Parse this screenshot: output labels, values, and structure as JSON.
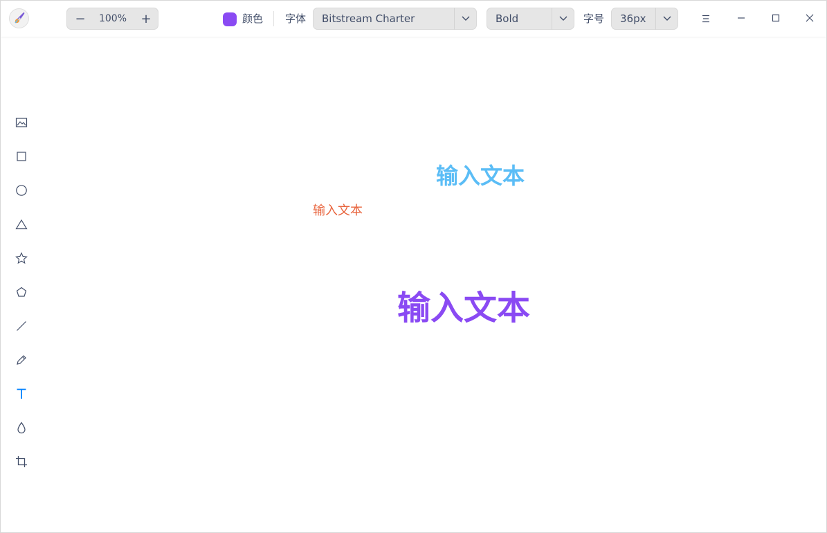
{
  "titlebar": {
    "zoom": {
      "value": "100%",
      "minus_label": "−",
      "plus_label": "+"
    },
    "color": {
      "label": "颜色",
      "value": "#8a4af3"
    },
    "font": {
      "label": "字体",
      "family": "Bitstream Charter",
      "weight": "Bold"
    },
    "size": {
      "label": "字号",
      "value": "36px"
    },
    "window_controls": [
      "menu-icon",
      "minimize-icon",
      "maximize-icon",
      "close-icon"
    ]
  },
  "tools": [
    {
      "name": "image-icon",
      "active": false
    },
    {
      "name": "rectangle-icon",
      "active": false
    },
    {
      "name": "ellipse-icon",
      "active": false
    },
    {
      "name": "triangle-icon",
      "active": false
    },
    {
      "name": "star-icon",
      "active": false
    },
    {
      "name": "polygon-icon",
      "active": false
    },
    {
      "name": "line-icon",
      "active": false
    },
    {
      "name": "pencil-icon",
      "active": false
    },
    {
      "name": "text-icon",
      "active": true
    },
    {
      "name": "blur-icon",
      "active": false
    },
    {
      "name": "crop-icon",
      "active": false
    }
  ],
  "canvas": {
    "texts": [
      {
        "text": "输入文本",
        "color": "#5bbdf6",
        "weight": "bold"
      },
      {
        "text": "输入文本",
        "color": "#e8643d",
        "weight": "normal"
      },
      {
        "text": "输入文本",
        "color": "#8a4af3",
        "weight": "bold"
      }
    ]
  },
  "colors": {
    "accent": "#0081ff",
    "icon": "#414d68"
  }
}
